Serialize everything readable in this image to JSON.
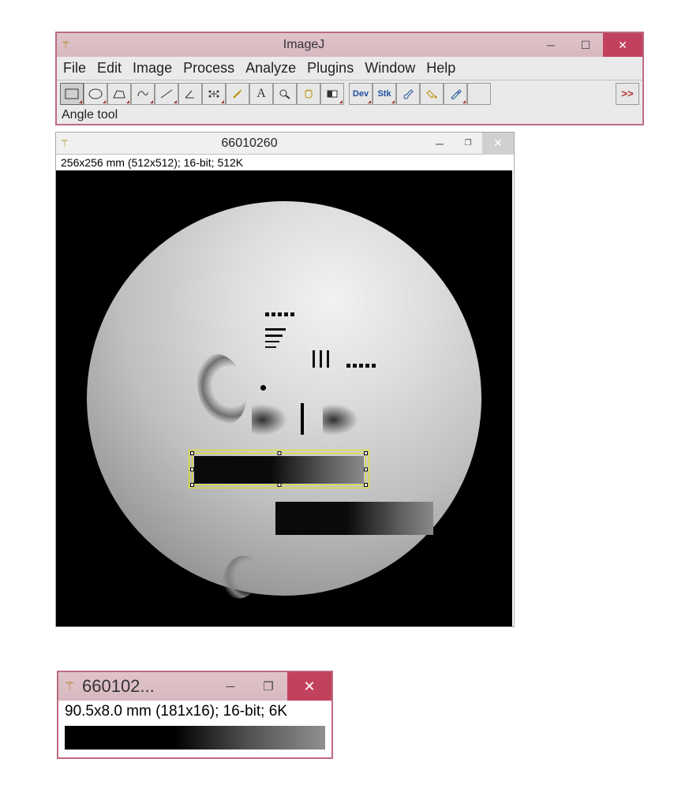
{
  "main_window": {
    "title": "ImageJ",
    "status": "Angle tool"
  },
  "menu": {
    "file": "File",
    "edit": "Edit",
    "image": "Image",
    "process": "Process",
    "analyze": "Analyze",
    "plugins": "Plugins",
    "window": "Window",
    "help": "Help"
  },
  "toolbar": {
    "dev": "Dev",
    "stk": "Stk",
    "more": ">>"
  },
  "image_window": {
    "title": "66010260",
    "info": "256x256 mm (512x512); 16-bit; 512K"
  },
  "crop_window": {
    "title": "660102...",
    "info": "90.5x8.0 mm (181x16); 16-bit; 6K"
  }
}
